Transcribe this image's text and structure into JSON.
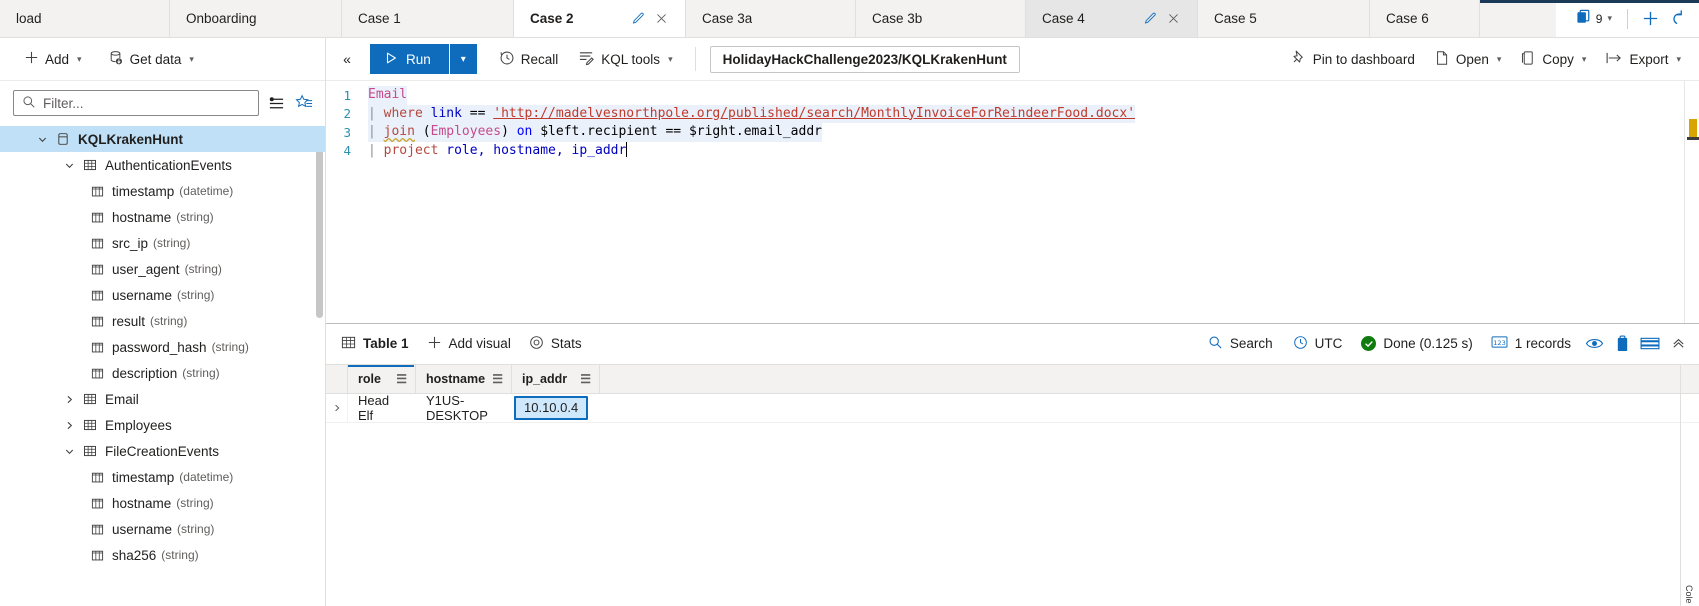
{
  "tabs": [
    {
      "label": "load",
      "state": "normal"
    },
    {
      "label": "Onboarding",
      "state": "normal"
    },
    {
      "label": "Case 1",
      "state": "normal"
    },
    {
      "label": "Case 2",
      "state": "active"
    },
    {
      "label": "Case 3a",
      "state": "normal"
    },
    {
      "label": "Case 3b",
      "state": "normal"
    },
    {
      "label": "Case 4",
      "state": "hover"
    },
    {
      "label": "Case 5",
      "state": "normal"
    },
    {
      "label": "Case 6",
      "state": "normal"
    }
  ],
  "tabstrip": {
    "copies_count": "9",
    "add_tab_label": "+",
    "undo_label": "undo"
  },
  "left_panel": {
    "add_label": "Add",
    "get_data_label": "Get data",
    "filter_placeholder": "Filter...",
    "tree": [
      {
        "label": "KQLKrakenHunt",
        "type": "",
        "icon": "database-icon",
        "level": 0,
        "expanded": true,
        "selected": true
      },
      {
        "label": "AuthenticationEvents",
        "type": "",
        "icon": "table-icon",
        "level": 1,
        "expanded": true,
        "selected": false
      },
      {
        "label": "timestamp",
        "type": "(datetime)",
        "icon": "column-icon",
        "level": 2,
        "expanded": null,
        "selected": false
      },
      {
        "label": "hostname",
        "type": "(string)",
        "icon": "column-icon",
        "level": 2,
        "expanded": null,
        "selected": false
      },
      {
        "label": "src_ip",
        "type": "(string)",
        "icon": "column-icon",
        "level": 2,
        "expanded": null,
        "selected": false
      },
      {
        "label": "user_agent",
        "type": "(string)",
        "icon": "column-icon",
        "level": 2,
        "expanded": null,
        "selected": false
      },
      {
        "label": "username",
        "type": "(string)",
        "icon": "column-icon",
        "level": 2,
        "expanded": null,
        "selected": false
      },
      {
        "label": "result",
        "type": "(string)",
        "icon": "column-icon",
        "level": 2,
        "expanded": null,
        "selected": false
      },
      {
        "label": "password_hash",
        "type": "(string)",
        "icon": "column-icon",
        "level": 2,
        "expanded": null,
        "selected": false
      },
      {
        "label": "description",
        "type": "(string)",
        "icon": "column-icon",
        "level": 2,
        "expanded": null,
        "selected": false
      },
      {
        "label": "Email",
        "type": "",
        "icon": "table-icon",
        "level": 1,
        "expanded": false,
        "selected": false
      },
      {
        "label": "Employees",
        "type": "",
        "icon": "table-icon",
        "level": 1,
        "expanded": false,
        "selected": false
      },
      {
        "label": "FileCreationEvents",
        "type": "",
        "icon": "table-icon",
        "level": 1,
        "expanded": true,
        "selected": false
      },
      {
        "label": "timestamp",
        "type": "(datetime)",
        "icon": "column-icon",
        "level": 2,
        "expanded": null,
        "selected": false
      },
      {
        "label": "hostname",
        "type": "(string)",
        "icon": "column-icon",
        "level": 2,
        "expanded": null,
        "selected": false
      },
      {
        "label": "username",
        "type": "(string)",
        "icon": "column-icon",
        "level": 2,
        "expanded": null,
        "selected": false
      },
      {
        "label": "sha256",
        "type": "(string)",
        "icon": "column-icon",
        "level": 2,
        "expanded": null,
        "selected": false
      }
    ]
  },
  "query_toolbar": {
    "run_label": "Run",
    "recall_label": "Recall",
    "kql_tools_label": "KQL tools",
    "database_path": "HolidayHackChallenge2023/KQLKrakenHunt",
    "pin_label": "Pin to dashboard",
    "open_label": "Open",
    "copy_label": "Copy",
    "export_label": "Export"
  },
  "editor": {
    "lines": [
      {
        "num": "1"
      },
      {
        "num": "2"
      },
      {
        "num": "3"
      },
      {
        "num": "4"
      }
    ],
    "line1_table": "Email",
    "line2_pipe": "|",
    "line2_where": "where",
    "line2_col": "link",
    "line2_op": "==",
    "line2_str": "'http://madelvesnorthpole.org/published/search/MonthlyInvoiceForReindeerFood.docx'",
    "line3_pipe": "|",
    "line3_join": "join",
    "line3_open": "(",
    "line3_table": "Employees",
    "line3_close": ")",
    "line3_on": "on",
    "line3_left": "$left.recipient",
    "line3_op": "==",
    "line3_right": "$right.email_addr",
    "line4_pipe": "|",
    "line4_project": "project",
    "line4_cols": " role, hostname, ip_addr"
  },
  "results_toolbar": {
    "table_label": "Table 1",
    "add_visual_label": "Add visual",
    "stats_label": "Stats",
    "search_label": "Search",
    "timezone_label": "UTC",
    "status_label": "Done (0.125 s)",
    "records_label": "1 records"
  },
  "grid": {
    "columns": [
      "role",
      "hostname",
      "ip_addr"
    ],
    "rows": [
      {
        "role": "Head Elf",
        "hostname": "Y1US-DESKTOP",
        "ip_addr": "10.10.0.4",
        "selected_cell": "ip_addr"
      }
    ],
    "rotated_label": "Cole"
  },
  "colors": {
    "accent": "#0f6cbd",
    "titlebar": "#1b3a57",
    "selection": "#bfe0f7",
    "success": "#107c10",
    "cell_select": "#cfe8fb"
  }
}
